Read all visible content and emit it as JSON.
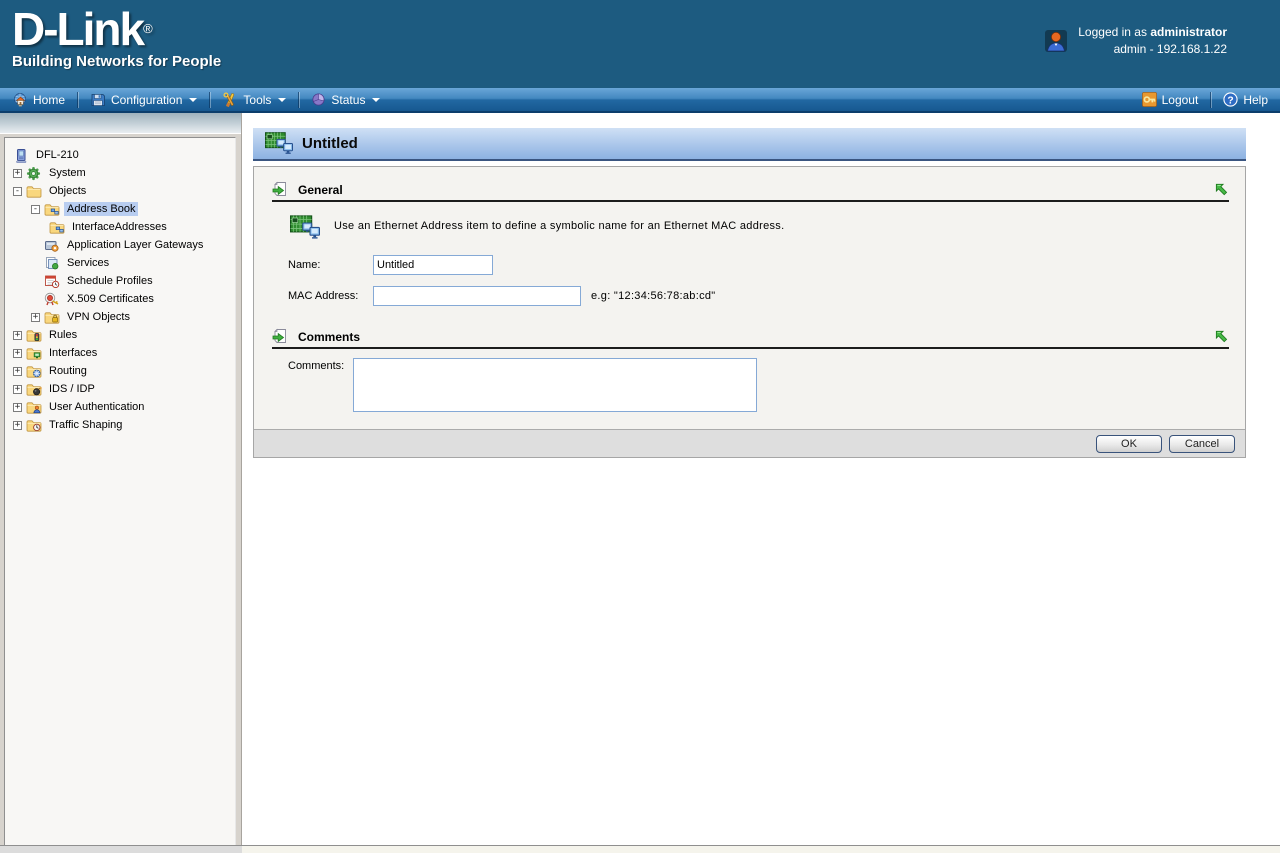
{
  "header": {
    "logo_title": "D-Link",
    "logo_registered": "®",
    "logo_tagline": "Building Networks for People",
    "logged_in_prefix": "Logged in as ",
    "logged_in_user": "administrator",
    "logged_in_detail": "admin - 192.168.1.22"
  },
  "navbar": {
    "home_label": "Home",
    "configuration_label": "Configuration",
    "tools_label": "Tools",
    "status_label": "Status",
    "logout_label": "Logout",
    "help_label": "Help"
  },
  "sidebar": {
    "tree": [
      {
        "label": "DFL-210",
        "expander": ""
      },
      {
        "label": "System",
        "expander": "+"
      },
      {
        "label": "Objects",
        "expander": "-"
      },
      {
        "label": "Address Book",
        "expander": "-"
      },
      {
        "label": "InterfaceAddresses",
        "expander": ""
      },
      {
        "label": "Application Layer Gateways",
        "expander": ""
      },
      {
        "label": "Services",
        "expander": ""
      },
      {
        "label": "Schedule Profiles",
        "expander": ""
      },
      {
        "label": "X.509 Certificates",
        "expander": ""
      },
      {
        "label": "VPN Objects",
        "expander": "+"
      },
      {
        "label": "Rules",
        "expander": "+"
      },
      {
        "label": "Interfaces",
        "expander": "+"
      },
      {
        "label": "Routing",
        "expander": "+"
      },
      {
        "label": "IDS / IDP",
        "expander": "+"
      },
      {
        "label": "User Authentication",
        "expander": "+"
      },
      {
        "label": "Traffic Shaping",
        "expander": "+"
      }
    ]
  },
  "main": {
    "page_title": "Untitled",
    "general": {
      "title": "General",
      "description": "Use an Ethernet Address item to define a symbolic name for an Ethernet MAC address.",
      "name_label": "Name:",
      "name_value": "Untitled",
      "mac_label": "MAC Address:",
      "mac_value": "",
      "mac_hint": "e.g: \"12:34:56:78:ab:cd\""
    },
    "comments": {
      "title": "Comments",
      "label": "Comments:",
      "value": ""
    },
    "ok_label": "OK",
    "cancel_label": "Cancel"
  },
  "colors": {
    "header_blue": "#1d5b80",
    "navbar_blue": "#2268a2",
    "titlebar_blue": "#aac6ea",
    "tree_selection": "#b8cdf0",
    "section_green": "#3faf3f",
    "input_border": "#85a9d6"
  }
}
